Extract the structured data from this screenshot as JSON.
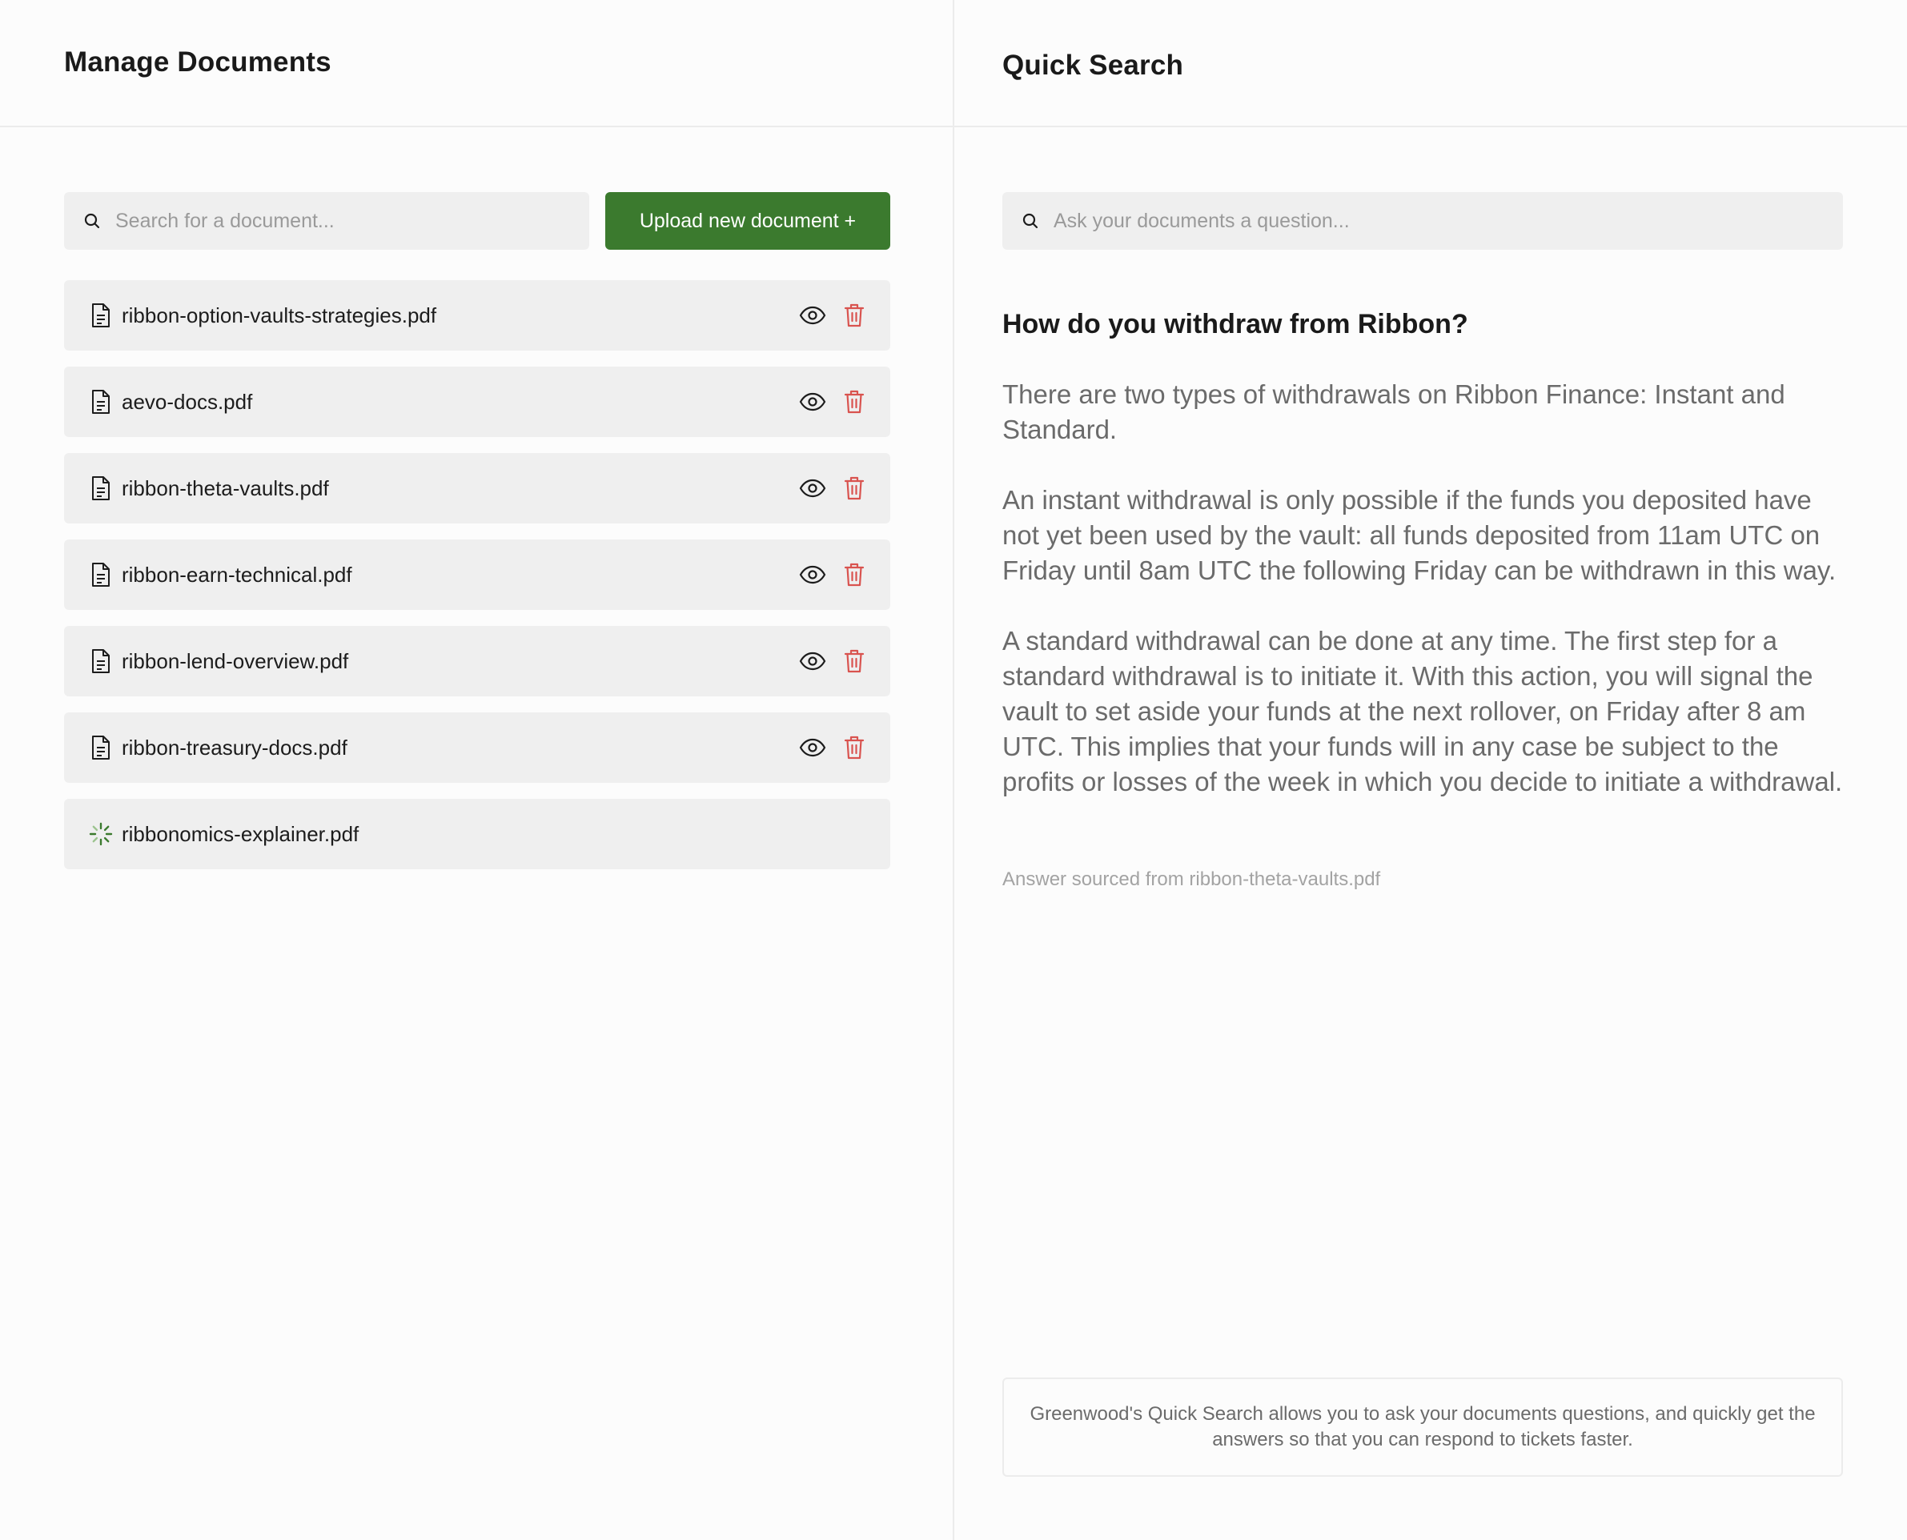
{
  "left_panel": {
    "title": "Manage Documents",
    "search": {
      "placeholder": "Search for a document...",
      "value": ""
    },
    "upload_button": {
      "label": "Upload new document +",
      "color": "#3b7a2e"
    },
    "documents": [
      {
        "name": "ribbon-option-vaults-strategies.pdf",
        "status": "ready"
      },
      {
        "name": "aevo-docs.pdf",
        "status": "ready"
      },
      {
        "name": "ribbon-theta-vaults.pdf",
        "status": "ready"
      },
      {
        "name": "ribbon-earn-technical.pdf",
        "status": "ready"
      },
      {
        "name": "ribbon-lend-overview.pdf",
        "status": "ready"
      },
      {
        "name": "ribbon-treasury-docs.pdf",
        "status": "ready"
      },
      {
        "name": "ribbonomics-explainer.pdf",
        "status": "loading"
      }
    ],
    "icons": {
      "file": "file-text-icon",
      "view": "eye-icon",
      "delete": "trash-icon",
      "loading": "spinner-icon"
    },
    "delete_color": "#d9534f"
  },
  "right_panel": {
    "title": "Quick Search",
    "search": {
      "placeholder": "Ask your documents a question...",
      "value": ""
    },
    "question": "How do you withdraw from Ribbon?",
    "answer_paragraphs": [
      "There are two types of withdrawals on Ribbon Finance: Instant and Standard.",
      "An instant withdrawal is only possible if the funds you deposited have not yet been used by the vault: all funds deposited from 11am UTC on Friday until 8am UTC the following Friday can be withdrawn in this way.",
      "A standard withdrawal can be done at any time. The first step for a standard withdrawal is to initiate it. With this action, you will signal the vault to set aside your funds at the next rollover, on Friday after 8 am UTC. This implies that your funds will in any case be subject to the profits or losses of the week in which you decide to initiate a withdrawal."
    ],
    "source": "Answer sourced from ribbon-theta-vaults.pdf",
    "info": "Greenwood's Quick Search allows you to ask your documents questions, and quickly get the answers so that you can respond to tickets faster."
  }
}
